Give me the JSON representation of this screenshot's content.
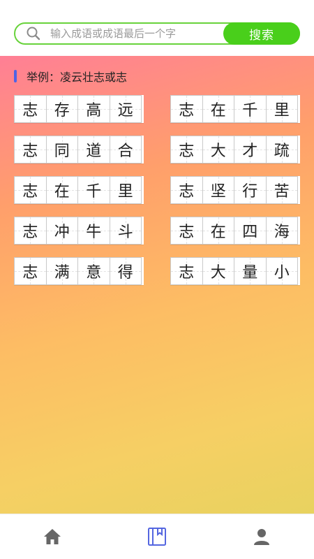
{
  "search": {
    "icon": "search-icon",
    "placeholder": "输入成语或成语最后一个字",
    "value": "",
    "button_label": "搜索",
    "accent_color": "#49cf1b"
  },
  "example": {
    "prefix": "举例：",
    "text": "凌云壮志或志"
  },
  "idioms": [
    [
      "志",
      "存",
      "高",
      "远"
    ],
    [
      "志",
      "在",
      "千",
      "里"
    ],
    [
      "志",
      "同",
      "道",
      "合"
    ],
    [
      "志",
      "大",
      "才",
      "疏"
    ],
    [
      "志",
      "在",
      "千",
      "里"
    ],
    [
      "志",
      "坚",
      "行",
      "苦"
    ],
    [
      "志",
      "冲",
      "牛",
      "斗"
    ],
    [
      "志",
      "在",
      "四",
      "海"
    ],
    [
      "志",
      "满",
      "意",
      "得"
    ],
    [
      "志",
      "大",
      "量",
      "小"
    ]
  ],
  "bottom_nav": [
    {
      "icon": "home-icon",
      "active": false
    },
    {
      "icon": "book-icon",
      "active": true
    },
    {
      "icon": "user-icon",
      "active": false
    }
  ]
}
